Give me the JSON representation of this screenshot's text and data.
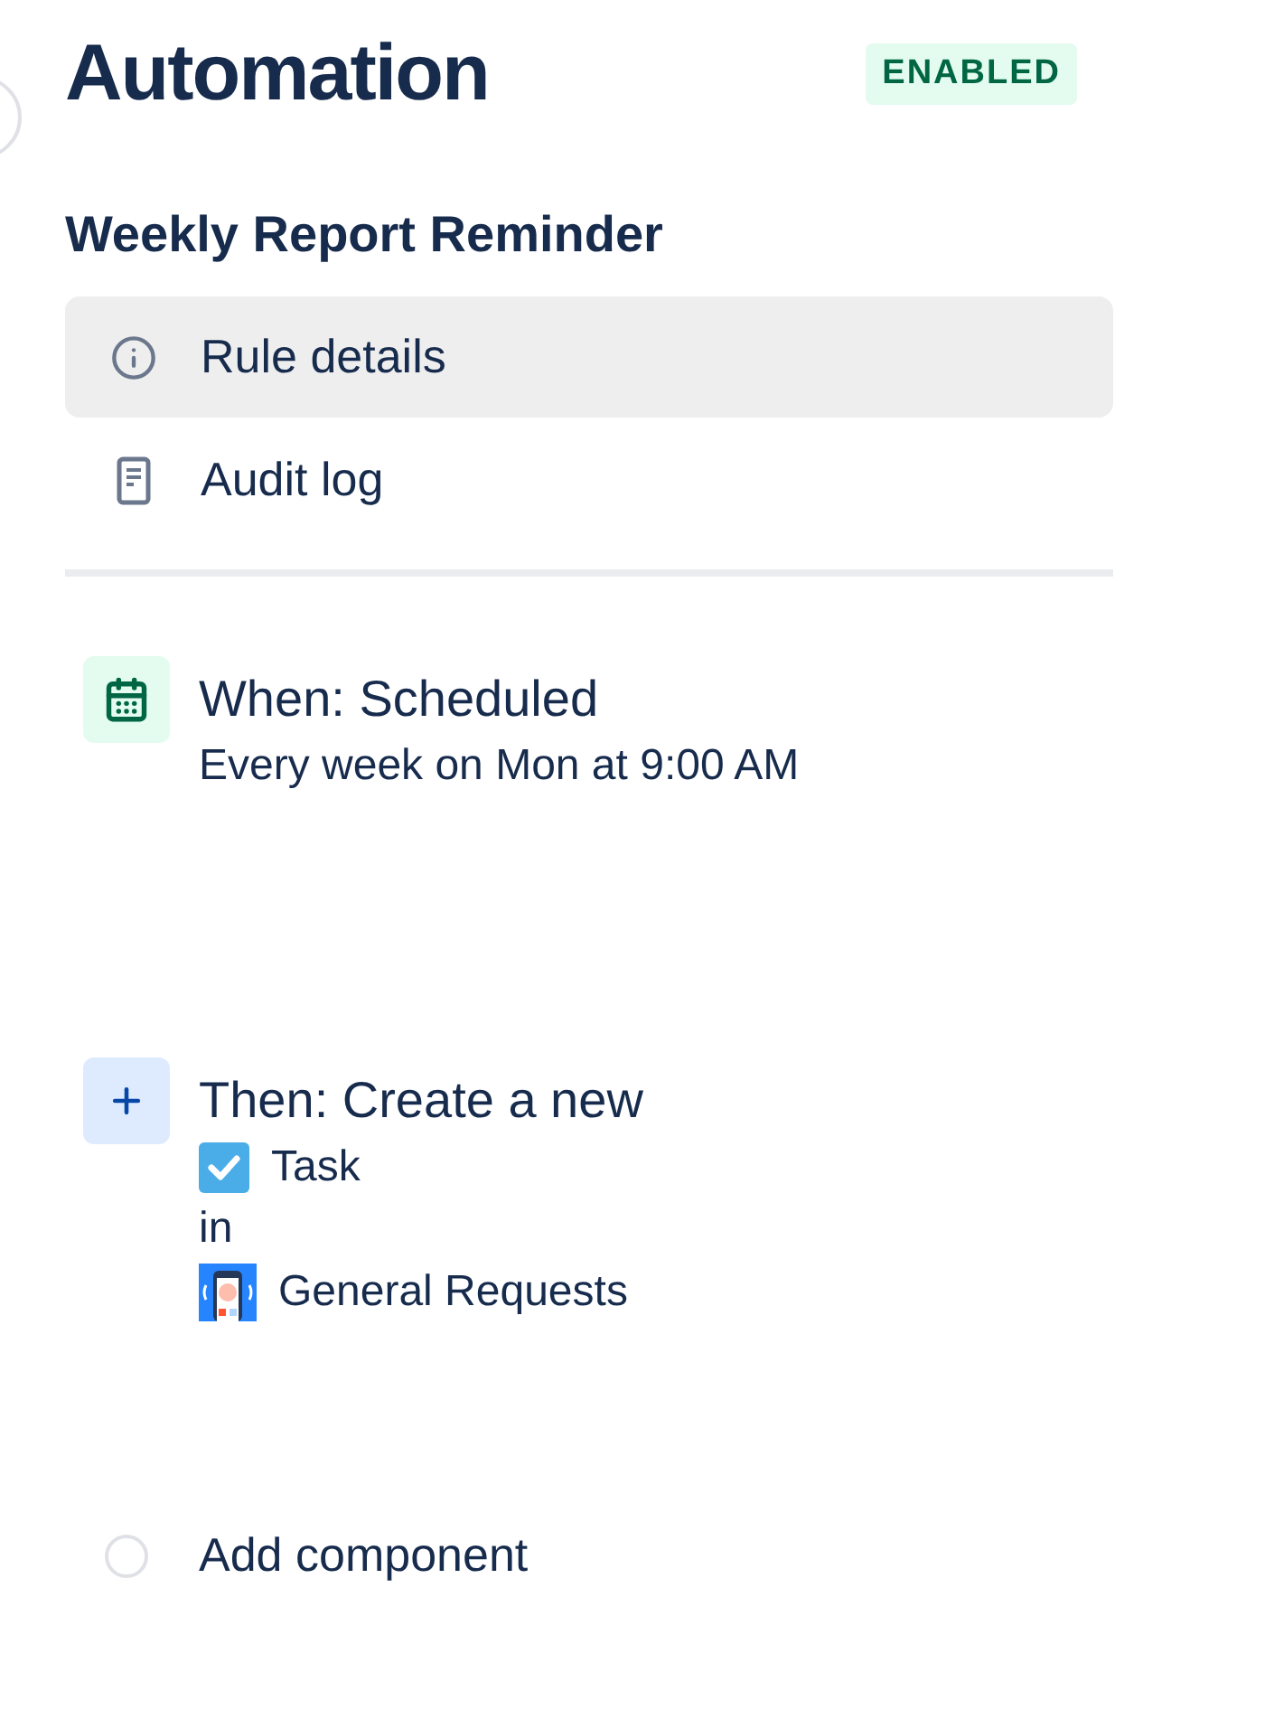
{
  "header": {
    "title": "Automation",
    "status": "ENABLED"
  },
  "rule": {
    "name": "Weekly Report Reminder"
  },
  "nav": [
    {
      "kind": "info",
      "label": "Rule details",
      "selected": true
    },
    {
      "kind": "log",
      "label": "Audit log",
      "selected": false
    }
  ],
  "components": [
    {
      "kind": "trigger",
      "title": "When: Scheduled",
      "details": [
        {
          "text": "Every week on Mon at 9:00 AM"
        }
      ]
    },
    {
      "kind": "action",
      "title": "Then: Create a new",
      "details": [
        {
          "kind": "task",
          "text": "Task"
        },
        {
          "kind": "plain",
          "text": "in"
        },
        {
          "kind": "project",
          "text": "General Requests"
        }
      ]
    },
    {
      "kind": "add",
      "title": "Add component"
    }
  ]
}
